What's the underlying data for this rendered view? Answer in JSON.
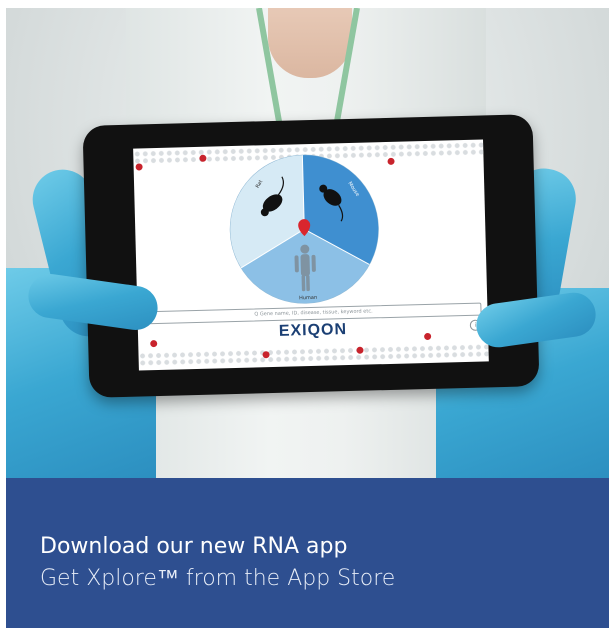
{
  "photo": {
    "tablet_app": {
      "wheel_labels": {
        "rat": "Rat",
        "mouse": "Mouse",
        "human": "Human"
      },
      "search_placeholder": "Q  Gene name, ID, disease, tissue, keyword etc.",
      "brand": "EXIQON",
      "info_symbol": "i"
    }
  },
  "banner": {
    "headline": "Download our new RNA app",
    "subline": "Get Xplore™ from the App Store",
    "background_color": "#2e4f90"
  }
}
